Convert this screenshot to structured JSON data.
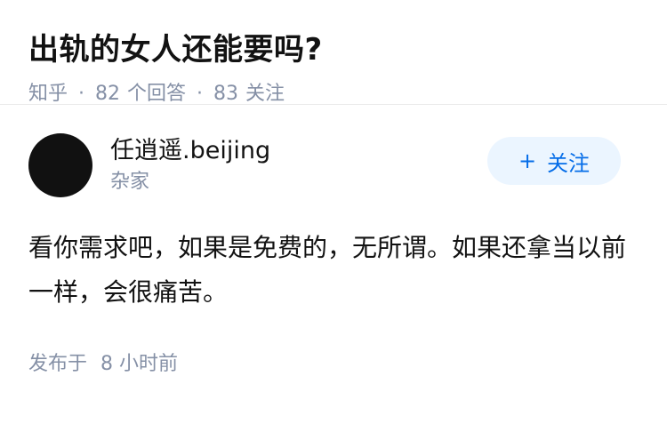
{
  "question": {
    "title": "出轨的女人还能要吗?",
    "source": "知乎",
    "answer_count": "82",
    "answer_label": "个回答",
    "follower_count": "83",
    "follower_label": "关注"
  },
  "answer": {
    "author_name": "任逍遥.beijing",
    "author_bio": "杂家",
    "follow_label": "关注",
    "follow_icon": "plus-icon",
    "content": "看你需求吧，如果是免费的，无所谓。如果还拿当以前一样，会很痛苦。",
    "publish_label": "发布于",
    "publish_time": "8 小时前"
  },
  "colors": {
    "accent": "#056de8",
    "accent_bg": "#ebf5ff",
    "meta": "#8590a6",
    "text": "#121212"
  }
}
